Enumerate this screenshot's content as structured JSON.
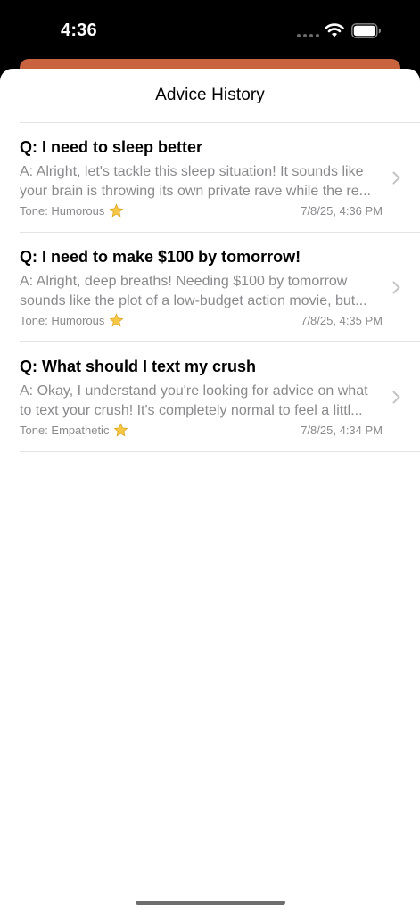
{
  "status_bar": {
    "time": "4:36"
  },
  "sheet": {
    "title": "Advice History"
  },
  "history": [
    {
      "question": "Q: I need to sleep better",
      "answer": "A: Alright, let's tackle this sleep situation! It sounds like your brain is throwing its own private rave while the re...",
      "tone": "Tone: Humorous",
      "date": "7/8/25, 4:36 PM"
    },
    {
      "question": "Q: I need to make $100 by tomorrow!",
      "answer": "A: Alright, deep breaths! Needing $100 by tomorrow sounds like the plot of a low-budget action movie, but...",
      "tone": "Tone: Humorous",
      "date": "7/8/25, 4:35 PM"
    },
    {
      "question": "Q: What should I text my crush",
      "answer": "A: Okay, I understand you're looking for advice on what to text your crush! It's completely normal to feel a littl...",
      "tone": "Tone: Empathetic",
      "date": "7/8/25, 4:34 PM"
    }
  ],
  "colors": {
    "accent_strip": "#c9623f",
    "secondary_text": "#8a8a8e",
    "separator": "#e3e3e6",
    "star": "#f5c518"
  },
  "icons": {
    "status": [
      "signal-dots-icon",
      "wifi-icon",
      "battery-icon"
    ],
    "row_badge": "star-icon",
    "row_disclosure": "chevron-right-icon"
  }
}
